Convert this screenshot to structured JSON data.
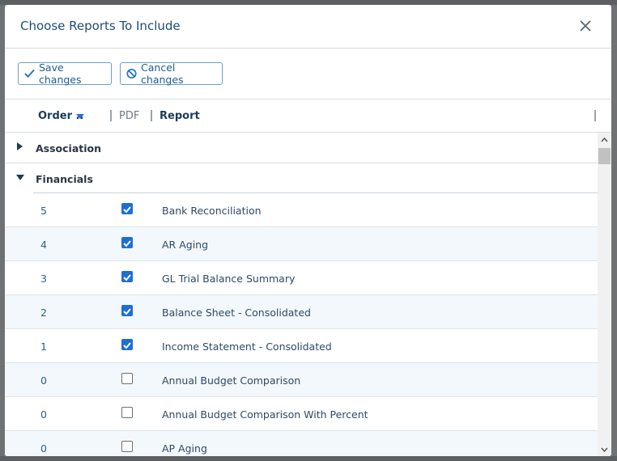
{
  "dialog": {
    "title": "Choose Reports To Include",
    "close_icon": "close-icon"
  },
  "toolbar": {
    "save_label": "Save changes",
    "save_icon": "checkmark-icon",
    "cancel_label": "Cancel changes",
    "cancel_icon": "cancel-circle-icon"
  },
  "grid": {
    "columns": {
      "order": "Order ..",
      "pdf": "PDF",
      "report": "Report"
    },
    "sort_icon": "sort-descending-icon",
    "groups": [
      {
        "label": "Association",
        "expanded": false
      },
      {
        "label": "Financials",
        "expanded": true
      }
    ],
    "rows": [
      {
        "order": "5",
        "checked": true,
        "report": "Bank Reconciliation"
      },
      {
        "order": "4",
        "checked": true,
        "report": "AR Aging"
      },
      {
        "order": "3",
        "checked": true,
        "report": "GL Trial Balance Summary"
      },
      {
        "order": "2",
        "checked": true,
        "report": "Balance Sheet - Consolidated"
      },
      {
        "order": "1",
        "checked": true,
        "report": "Income Statement - Consolidated"
      },
      {
        "order": "0",
        "checked": false,
        "report": "Annual Budget Comparison"
      },
      {
        "order": "0",
        "checked": false,
        "report": "Annual Budget Comparison With Percent"
      },
      {
        "order": "0",
        "checked": false,
        "report": "AP Aging"
      }
    ]
  },
  "colors": {
    "accent": "#1e6fd0",
    "title": "#1e4d78",
    "row_alt": "#f3f8fc"
  }
}
